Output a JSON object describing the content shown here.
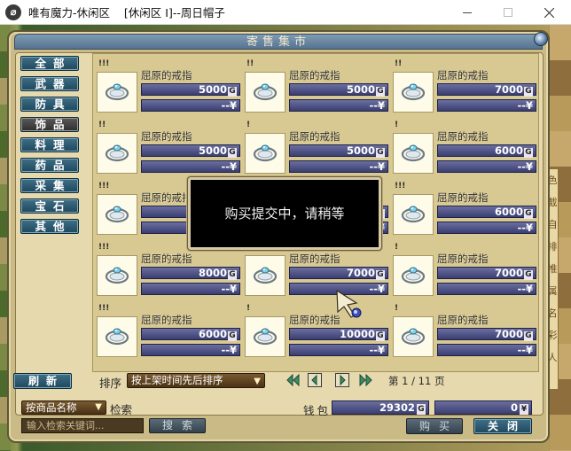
{
  "window": {
    "title": "唯有魔力-休闲区    [休闲区 I]--周日帽子",
    "icon_glyph": "⌀"
  },
  "panel": {
    "title": "寄售集市"
  },
  "categories": [
    {
      "label": "全部",
      "active": false
    },
    {
      "label": "武器",
      "active": false
    },
    {
      "label": "防具",
      "active": false
    },
    {
      "label": "饰品",
      "active": true
    },
    {
      "label": "料理",
      "active": false
    },
    {
      "label": "药品",
      "active": false
    },
    {
      "label": "采集",
      "active": false
    },
    {
      "label": "宝石",
      "active": false
    },
    {
      "label": "其他",
      "active": false
    }
  ],
  "refresh_label": "刷新",
  "items": [
    {
      "stars": "!!!",
      "name": "屈原的戒指",
      "price": "5000",
      "rmb": "--"
    },
    {
      "stars": "!!",
      "name": "屈原的戒指",
      "price": "5000",
      "rmb": "--"
    },
    {
      "stars": "!!",
      "name": "屈原的戒指",
      "price": "7000",
      "rmb": "--"
    },
    {
      "stars": "!!",
      "name": "屈原的戒指",
      "price": "5000",
      "rmb": "--"
    },
    {
      "stars": "!",
      "name": "屈原的戒指",
      "price": "5000",
      "rmb": "--"
    },
    {
      "stars": "!",
      "name": "屈原的戒指",
      "price": "6000",
      "rmb": "--"
    },
    {
      "stars": "!!!",
      "name": "屈原的戒指",
      "price": "",
      "rmb": "--"
    },
    {
      "stars": "",
      "name": "",
      "price": "",
      "rmb": ""
    },
    {
      "stars": "!!!",
      "name": "屈原的戒指",
      "price": "6000",
      "rmb": "--"
    },
    {
      "stars": "!!!",
      "name": "屈原的戒指",
      "price": "8000",
      "rmb": "--"
    },
    {
      "stars": "!",
      "name": "屈原的戒指",
      "price": "7000",
      "rmb": "--"
    },
    {
      "stars": "!",
      "name": "屈原的戒指",
      "price": "7000",
      "rmb": "--"
    },
    {
      "stars": "!!!",
      "name": "屈原的戒指",
      "price": "6000",
      "rmb": "--"
    },
    {
      "stars": "!",
      "name": "屈原的戒指",
      "price": "10000",
      "rmb": "--"
    },
    {
      "stars": "!",
      "name": "屈原的戒指",
      "price": "7000",
      "rmb": "--"
    }
  ],
  "gold_unit": "G",
  "rmb_unit": "¥",
  "modal": {
    "message": "购买提交中，请稍等"
  },
  "sort": {
    "label": "排序",
    "selected": "按上架时间先后排序"
  },
  "pager": {
    "text": "第 1 / 11 页"
  },
  "filter": {
    "selected": "按商品名称",
    "search_label": "检索",
    "search_placeholder": "输入检索关键词...",
    "search_button": "搜索"
  },
  "wallet": {
    "label": "钱包",
    "gold": "29302",
    "rmb": "0"
  },
  "buttons": {
    "buy": "购买",
    "close": "关闭"
  },
  "right_strip_chars": [
    "色",
    "截",
    "自",
    "排",
    "推",
    "属",
    "名",
    "彩",
    "人"
  ]
}
